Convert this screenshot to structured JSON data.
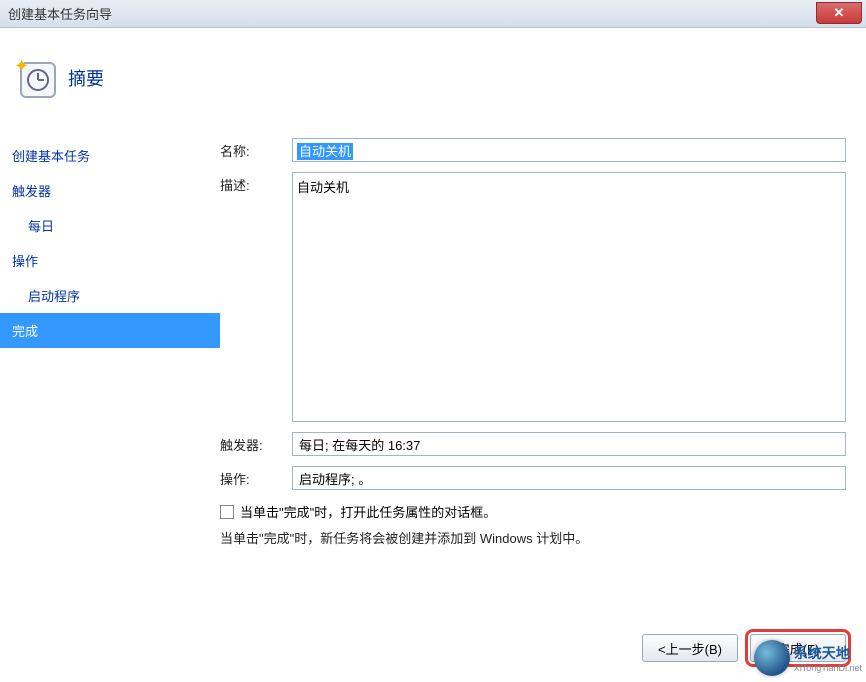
{
  "window": {
    "title": "创建基本任务向导"
  },
  "header": {
    "title": "摘要"
  },
  "sidebar": {
    "items": [
      {
        "label": "创建基本任务",
        "sub": false,
        "active": false
      },
      {
        "label": "触发器",
        "sub": false,
        "active": false
      },
      {
        "label": "每日",
        "sub": true,
        "active": false
      },
      {
        "label": "操作",
        "sub": false,
        "active": false
      },
      {
        "label": "启动程序",
        "sub": true,
        "active": false
      },
      {
        "label": "完成",
        "sub": false,
        "active": true
      }
    ]
  },
  "form": {
    "nameLabel": "名称:",
    "nameValue": "自动关机",
    "descLabel": "描述:",
    "descValue": "自动关机",
    "triggerLabel": "触发器:",
    "triggerValue": "每日; 在每天的 16:37",
    "actionLabel": "操作:",
    "actionValue": "启动程序; 。",
    "checkboxLabel": "当单击\"完成\"时，打开此任务属性的对话框。",
    "note": "当单击\"完成\"时，新任务将会被创建并添加到 Windows 计划中。"
  },
  "buttons": {
    "back": "<上一步(B)",
    "finish": "完成(F)"
  },
  "watermark": {
    "brand": "系统天地",
    "url": "XiTongTianDi.net"
  }
}
